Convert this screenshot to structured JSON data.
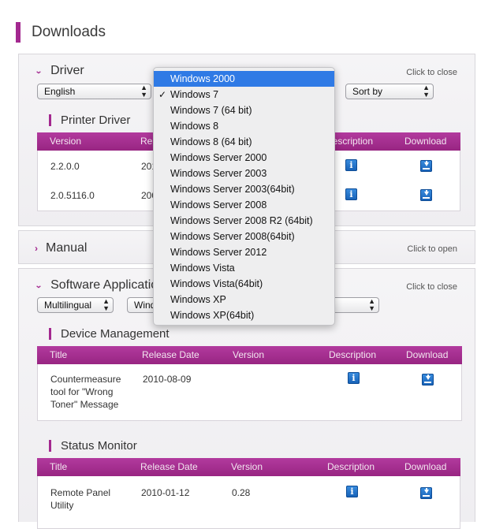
{
  "page": {
    "title": "Downloads"
  },
  "driver": {
    "title": "Driver",
    "toggle": "Click to close",
    "language": "English",
    "sort": "Sort by",
    "printer_driver": {
      "title": "Printer Driver",
      "headers": {
        "version": "Version",
        "release": "Re",
        "description": "Description",
        "download": "Download"
      },
      "rows": [
        {
          "version": "2.2.0.0",
          "release": "201"
        },
        {
          "version": "2.0.5116.0",
          "release": "200"
        }
      ]
    }
  },
  "manual": {
    "title": "Manual",
    "toggle": "Click to open"
  },
  "software": {
    "title": "Software Applicatio",
    "toggle": "Click to close",
    "language": "Multilingual",
    "os": "Wind",
    "device_management": {
      "title": "Device Management",
      "headers": {
        "title": "Title",
        "release": "Release Date",
        "version": "Version",
        "description": "Description",
        "download": "Download"
      },
      "rows": [
        {
          "title": "Countermeasure tool for \"Wrong Toner\" Message",
          "release": "2010-08-09",
          "version": ""
        }
      ]
    },
    "status_monitor": {
      "title": "Status Monitor",
      "headers": {
        "title": "Title",
        "release": "Release Date",
        "version": "Version",
        "description": "Description",
        "download": "Download"
      },
      "rows": [
        {
          "title": "Remote Panel Utility",
          "release": "2010-01-12",
          "version": "0.28"
        }
      ]
    }
  },
  "os_dropdown": {
    "highlighted": "Windows 2000",
    "selected": "Windows 7",
    "options": [
      "Windows 2000",
      "Windows 7",
      "Windows 7 (64 bit)",
      "Windows 8",
      "Windows 8 (64 bit)",
      "Windows Server 2000",
      "Windows Server 2003",
      "Windows Server 2003(64bit)",
      "Windows Server 2008",
      "Windows Server 2008 R2 (64bit)",
      "Windows Server 2008(64bit)",
      "Windows Server 2012",
      "Windows Vista",
      "Windows Vista(64bit)",
      "Windows XP",
      "Windows XP(64bit)"
    ]
  },
  "icons": {
    "info": "info-icon",
    "download": "download-icon",
    "expanded": "chevron-down-icon",
    "collapsed": "chevron-right-icon",
    "checkmark": "checkmark-icon"
  },
  "colors": {
    "accent": "#a3288f",
    "header_bar": "#a52c90",
    "highlight": "#2f7ae5",
    "icon_blue": "#1e6fc8"
  }
}
